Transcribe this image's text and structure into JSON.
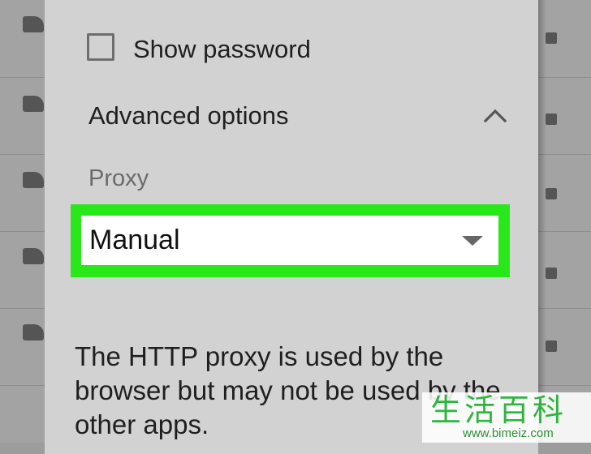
{
  "dialog": {
    "show_password_label": "Show password",
    "advanced_options_label": "Advanced options",
    "proxy_label": "Proxy",
    "proxy_value": "Manual",
    "info_text": "The HTTP proxy is used by the browser but may not be used by the other apps."
  },
  "icons": {
    "checkbox": "checkbox-unchecked-icon",
    "advanced_toggle": "chevron-up-icon",
    "dropdown": "caret-down-icon"
  },
  "colors": {
    "dialog_background": "#d2d2d2",
    "highlight": "#28e81a",
    "select_background": "#ffffff",
    "watermark": "#2db53c"
  },
  "watermark": {
    "title": "生活百科",
    "url": "www.bimeiz.com"
  }
}
